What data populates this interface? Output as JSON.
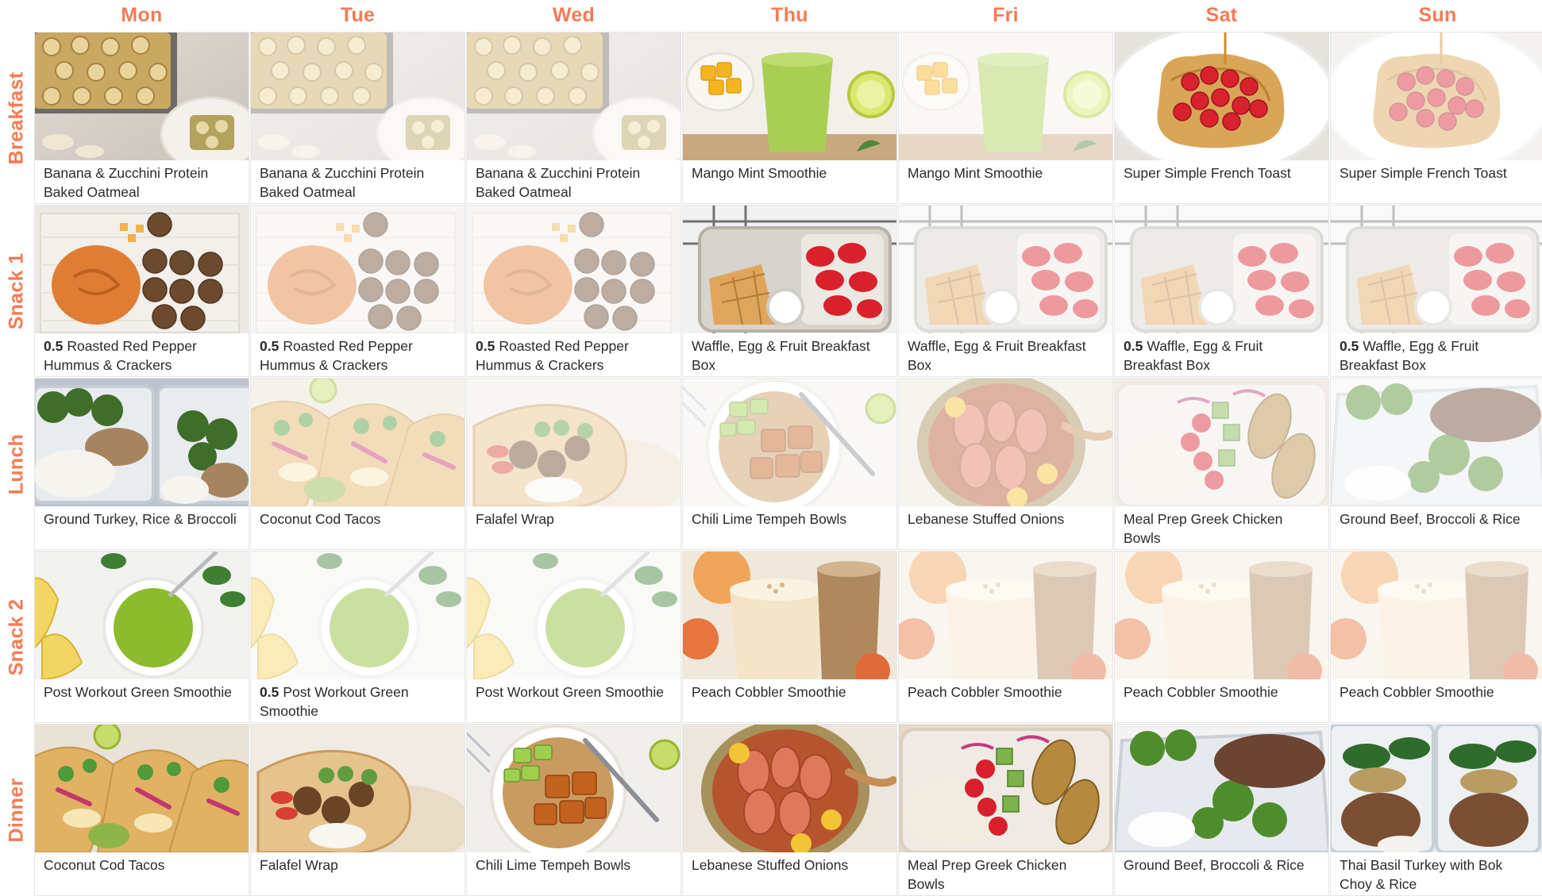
{
  "days": [
    "Mon",
    "Tue",
    "Wed",
    "Thu",
    "Fri",
    "Sat",
    "Sun"
  ],
  "colors": {
    "accent": "#f47b55",
    "text": "#2a2a2a",
    "border": "#e6e6e6"
  },
  "meals": [
    {
      "label": "Breakfast",
      "cells": [
        {
          "title": "Banana & Zucchini Protein Baked Oatmeal",
          "qty": "",
          "image": "baked-oatmeal-photo",
          "leftover": false
        },
        {
          "title": "Banana & Zucchini Protein Baked Oatmeal",
          "qty": "",
          "image": "baked-oatmeal-photo",
          "leftover": true
        },
        {
          "title": "Banana & Zucchini Protein Baked Oatmeal",
          "qty": "",
          "image": "baked-oatmeal-photo",
          "leftover": true
        },
        {
          "title": "Mango Mint Smoothie",
          "qty": "",
          "image": "green-smoothie-mango-photo",
          "leftover": false
        },
        {
          "title": "Mango Mint Smoothie",
          "qty": "",
          "image": "green-smoothie-mango-photo",
          "leftover": true
        },
        {
          "title": "Super Simple French Toast",
          "qty": "",
          "image": "french-toast-raspberry-photo",
          "leftover": false
        },
        {
          "title": "Super Simple French Toast",
          "qty": "",
          "image": "french-toast-raspberry-photo",
          "leftover": true
        }
      ]
    },
    {
      "label": "Snack 1",
      "cells": [
        {
          "title": "Roasted Red Pepper Hummus & Crackers",
          "qty": "0.5",
          "image": "hummus-crackers-photo",
          "leftover": false
        },
        {
          "title": "Roasted Red Pepper Hummus & Crackers",
          "qty": "0.5",
          "image": "hummus-crackers-photo",
          "leftover": true
        },
        {
          "title": "Roasted Red Pepper Hummus & Crackers",
          "qty": "0.5",
          "image": "hummus-crackers-photo",
          "leftover": true
        },
        {
          "title": "Waffle, Egg & Fruit Breakfast Box",
          "qty": "",
          "image": "waffle-box-photo",
          "leftover": false
        },
        {
          "title": "Waffle, Egg & Fruit Breakfast Box",
          "qty": "",
          "image": "waffle-box-photo",
          "leftover": true
        },
        {
          "title": "Waffle, Egg & Fruit Breakfast Box",
          "qty": "0.5",
          "image": "waffle-box-photo",
          "leftover": true
        },
        {
          "title": "Waffle, Egg & Fruit Breakfast Box",
          "qty": "0.5",
          "image": "waffle-box-photo",
          "leftover": true
        }
      ]
    },
    {
      "label": "Lunch",
      "cells": [
        {
          "title": "Ground Turkey, Rice & Broccoli",
          "qty": "",
          "image": "turkey-rice-broccoli-photo",
          "leftover": false
        },
        {
          "title": "Coconut Cod Tacos",
          "qty": "",
          "image": "fish-tacos-photo",
          "leftover": true
        },
        {
          "title": "Falafel Wrap",
          "qty": "",
          "image": "falafel-wrap-photo",
          "leftover": true
        },
        {
          "title": "Chili Lime Tempeh Bowls",
          "qty": "",
          "image": "tempeh-bowl-photo",
          "leftover": true
        },
        {
          "title": "Lebanese Stuffed Onions",
          "qty": "",
          "image": "stuffed-onions-photo",
          "leftover": true
        },
        {
          "title": "Meal Prep Greek Chicken Bowls",
          "qty": "",
          "image": "greek-chicken-photo",
          "leftover": true
        },
        {
          "title": "Ground Beef, Broccoli & Rice",
          "qty": "",
          "image": "beef-broccoli-photo",
          "leftover": true
        }
      ]
    },
    {
      "label": "Snack 2",
      "cells": [
        {
          "title": "Post Workout Green Smoothie",
          "qty": "",
          "image": "green-smoothie-banana-photo",
          "leftover": false
        },
        {
          "title": "Post Workout Green Smoothie",
          "qty": "0.5",
          "image": "green-smoothie-banana-photo",
          "leftover": true
        },
        {
          "title": "Post Workout Green Smoothie",
          "qty": "",
          "image": "green-smoothie-banana-photo",
          "leftover": true
        },
        {
          "title": "Peach Cobbler Smoothie",
          "qty": "",
          "image": "peach-smoothie-photo",
          "leftover": false
        },
        {
          "title": "Peach Cobbler Smoothie",
          "qty": "",
          "image": "peach-smoothie-photo",
          "leftover": true
        },
        {
          "title": "Peach Cobbler Smoothie",
          "qty": "",
          "image": "peach-smoothie-photo",
          "leftover": true
        },
        {
          "title": "Peach Cobbler Smoothie",
          "qty": "",
          "image": "peach-smoothie-photo",
          "leftover": true
        }
      ]
    },
    {
      "label": "Dinner",
      "cells": [
        {
          "title": "Coconut Cod Tacos",
          "qty": "",
          "image": "fish-tacos-photo",
          "leftover": false
        },
        {
          "title": "Falafel Wrap",
          "qty": "",
          "image": "falafel-wrap-photo",
          "leftover": false
        },
        {
          "title": "Chili Lime Tempeh Bowls",
          "qty": "",
          "image": "tempeh-bowl-photo",
          "leftover": false
        },
        {
          "title": "Lebanese Stuffed Onions",
          "qty": "",
          "image": "stuffed-onions-photo",
          "leftover": false
        },
        {
          "title": "Meal Prep Greek Chicken Bowls",
          "qty": "",
          "image": "greek-chicken-photo",
          "leftover": false
        },
        {
          "title": "Ground Beef, Broccoli & Rice",
          "qty": "",
          "image": "beef-broccoli-photo",
          "leftover": false
        },
        {
          "title": "Thai Basil Turkey with Bok Choy & Rice",
          "qty": "",
          "image": "thai-basil-turkey-photo",
          "leftover": false
        }
      ]
    }
  ]
}
